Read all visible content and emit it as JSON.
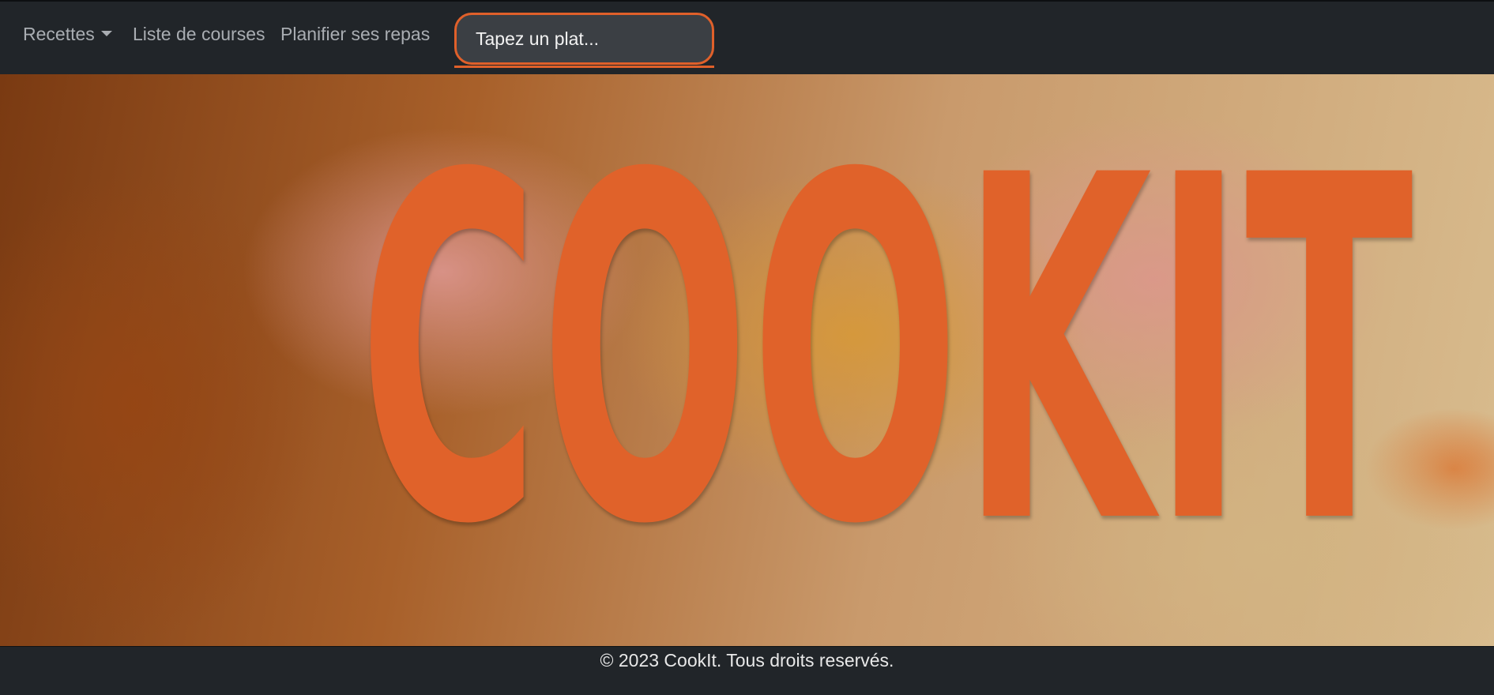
{
  "navbar": {
    "recipes_label": "Recettes",
    "shopping_list_label": "Liste de courses",
    "plan_meals_label": "Planifier ses repas",
    "search": {
      "placeholder": "Tapez un plat...",
      "value": ""
    }
  },
  "hero": {
    "title": "COOKIT"
  },
  "footer": {
    "copyright": "© 2023 CookIt. Tous droits reservés."
  },
  "colors": {
    "accent": "#e0602a",
    "nav_background": "#212529",
    "nav_text": "#a9adb2"
  }
}
